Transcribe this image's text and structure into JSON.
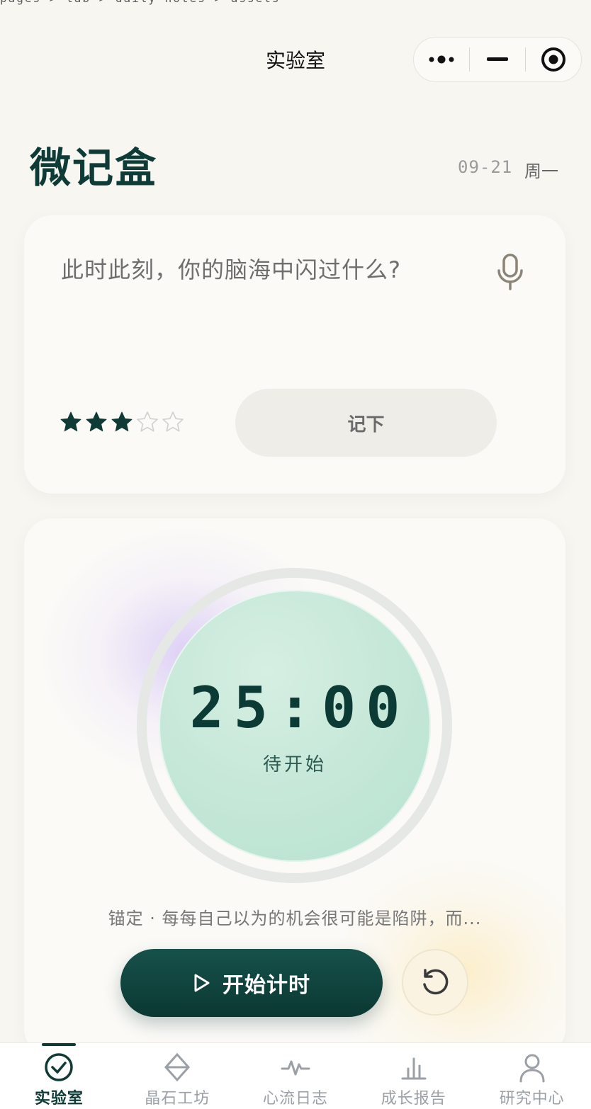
{
  "breadcrumb": "pages  >  lab  >  daily-notes  >  assets",
  "navbar": {
    "title": "实验室"
  },
  "header": {
    "brand": "微记盒",
    "date": "09-21",
    "weekday": "周一"
  },
  "note": {
    "placeholder": "此时此刻，你的脑海中闪过什么?",
    "rating": 3,
    "rating_max": 5,
    "submit_label": "记下"
  },
  "timer": {
    "time": "25:00",
    "status": "待开始",
    "quote": "锚定 · 每每自己以为的机会很可能是陷阱，而...",
    "start_label": "开始计时"
  },
  "tabbar": {
    "items": [
      {
        "label": "实验室",
        "icon": "check-circle-icon",
        "active": true
      },
      {
        "label": "晶石工坊",
        "icon": "diamond-icon",
        "active": false
      },
      {
        "label": "心流日志",
        "icon": "pulse-icon",
        "active": false
      },
      {
        "label": "成长报告",
        "icon": "bar-chart-icon",
        "active": false
      },
      {
        "label": "研究中心",
        "icon": "user-icon",
        "active": false
      }
    ]
  },
  "colors": {
    "brand_dark": "#0e3b36",
    "dial_green": "#c4e7d7",
    "background": "#f7f6f1",
    "inactive_gray": "#9aa0a6"
  }
}
